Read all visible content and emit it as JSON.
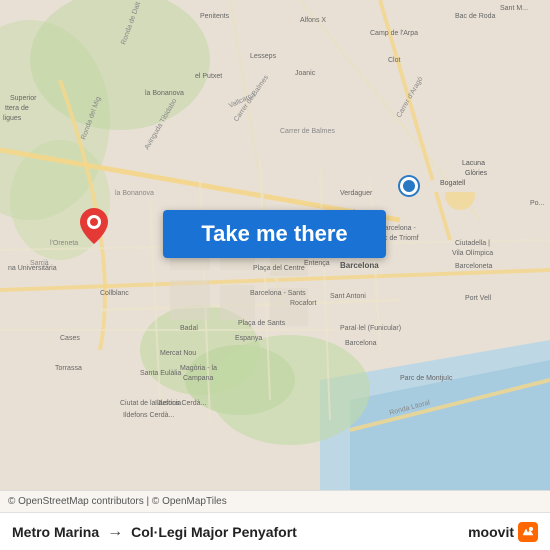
{
  "map": {
    "attribution": "© OpenStreetMap contributors | © OpenMapTiles",
    "button_label": "Take me there",
    "button_bg": "#1a73d4"
  },
  "info_bar": {
    "origin": "Metro Marina",
    "destination": "Col·Legi Major Penyafort",
    "arrow": "→"
  },
  "moovit": {
    "label": "moovit"
  }
}
